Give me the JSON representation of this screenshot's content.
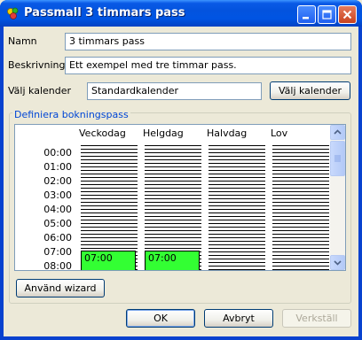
{
  "window": {
    "title": "Passmall 3 timmars pass",
    "icon": "app-icon",
    "controls": [
      "minimize-icon",
      "maximize-icon",
      "close-icon"
    ]
  },
  "form": {
    "name_label": "Namn",
    "name_value": "3 timmars pass",
    "description_label": "Beskrivning",
    "description_value": "Ett exempel med tre timmar pass.",
    "calendar_label": "Välj kalender",
    "calendar_value": "Standardkalender",
    "calendar_button": "Välj kalender"
  },
  "booking": {
    "group_title": "Definiera bokningspass",
    "columns": [
      "Veckodag",
      "Helgdag",
      "Halvdag",
      "Lov"
    ],
    "times": [
      "00:00",
      "01:00",
      "02:00",
      "03:00",
      "04:00",
      "05:00",
      "06:00",
      "07:00",
      "08:00"
    ],
    "slots": [
      {
        "column": "Veckodag",
        "start": "07:00"
      },
      {
        "column": "Helgdag",
        "start": "07:00"
      }
    ],
    "wizard_button": "Använd wizard"
  },
  "buttons": {
    "ok": "OK",
    "cancel": "Avbryt",
    "apply": "Verkställ"
  },
  "colors": {
    "titlebar": "#0054e3",
    "slot": "#33ff33",
    "group_title": "#0046d5"
  }
}
